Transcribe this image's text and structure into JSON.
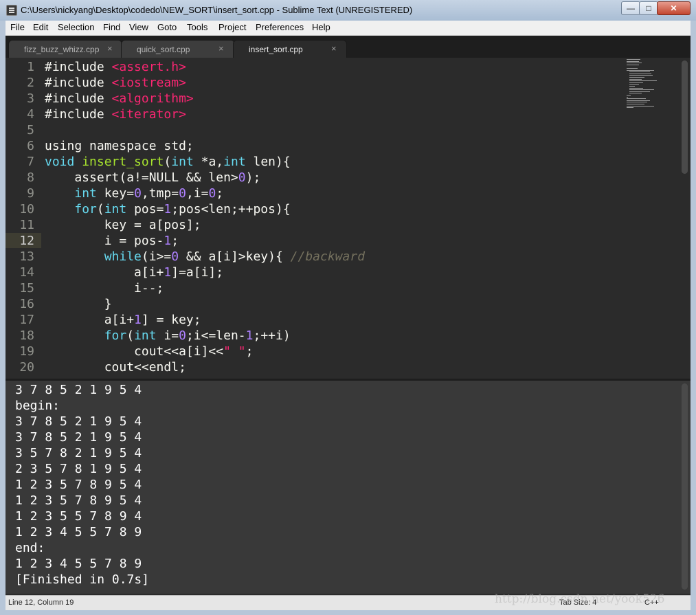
{
  "window": {
    "title": "C:\\Users\\nickyang\\Desktop\\codedo\\NEW_SORT\\insert_sort.cpp - Sublime Text (UNREGISTERED)",
    "minimize": "—",
    "maximize": "□",
    "close": "✕"
  },
  "menu": [
    "File",
    "Edit",
    "Selection",
    "Find",
    "View",
    "Goto",
    "Tools",
    "Project",
    "Preferences",
    "Help"
  ],
  "tabs": [
    {
      "label": "fizz_buzz_whizz.cpp",
      "close": "×",
      "active": false
    },
    {
      "label": "quick_sort.cpp",
      "close": "×",
      "active": false
    },
    {
      "label": "insert_sort.cpp",
      "close": "×",
      "active": true
    }
  ],
  "editor": {
    "current_line": 12,
    "line_numbers": [
      "1",
      "2",
      "3",
      "4",
      "5",
      "6",
      "7",
      "8",
      "9",
      "10",
      "11",
      "12",
      "13",
      "14",
      "15",
      "16",
      "17",
      "18",
      "19",
      "20"
    ]
  },
  "output": {
    "lines": [
      "3 7 8 5 2 1 9 5 4",
      "begin:",
      "3 7 8 5 2 1 9 5 4",
      "3 7 8 5 2 1 9 5 4",
      "3 5 7 8 2 1 9 5 4",
      "2 3 5 7 8 1 9 5 4",
      "1 2 3 5 7 8 9 5 4",
      "1 2 3 5 7 8 9 5 4",
      "1 2 3 5 5 7 8 9 4",
      "1 2 3 4 5 5 7 8 9",
      "end:",
      "1 2 3 4 5 5 7 8 9",
      "[Finished in 0.7s]"
    ]
  },
  "status": {
    "position": "Line 12, Column 19",
    "tab_size": "Tab Size: 4",
    "syntax": "C++"
  },
  "watermark": "http://blog.csdn.net/yook526",
  "colors": {
    "background": "#2b2b2b",
    "keyword": "#66d9ef",
    "function": "#a6e22e",
    "string": "#f92672",
    "number": "#ae81ff",
    "comment": "#75715e"
  }
}
